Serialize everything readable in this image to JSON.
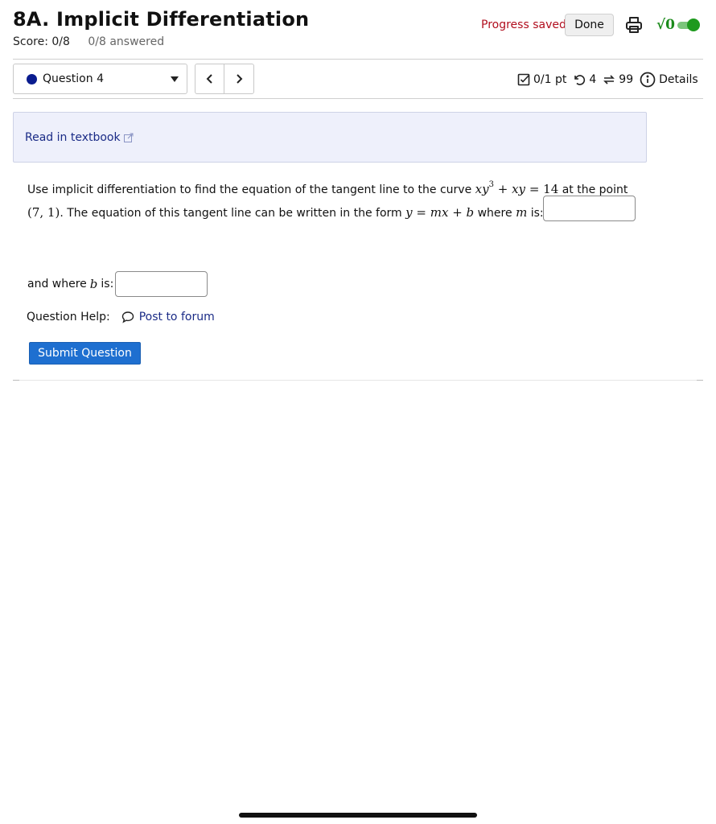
{
  "header": {
    "title": "8A. Implicit Differentiation",
    "score": "Score: 0/8",
    "answered": "0/8 answered",
    "progress_saved": "Progress saved",
    "done_label": "Done",
    "math_toggle_symbol": "√0",
    "math_toggle_on": true
  },
  "nav": {
    "question_label": "Question 4",
    "prev_symbol": "‹",
    "next_symbol": "›"
  },
  "meta": {
    "points": "0/1 pt",
    "attempts": "4",
    "versions": "99",
    "details_label": "Details"
  },
  "textbook": {
    "link_label": "Read in textbook"
  },
  "question": {
    "text_1": "Use implicit differentiation to find the equation of the tangent line to the curve",
    "text_2": "at the point",
    "text_3": ". The equation of this tangent line can be written in the form",
    "text_4": "where",
    "text_5": "is:",
    "b_prefix": "and where",
    "b_suffix": "is:",
    "m_value": "",
    "b_value": ""
  },
  "help": {
    "label": "Question Help:",
    "forum_label": "Post to forum"
  },
  "submit": {
    "label": "Submit Question"
  },
  "colors": {
    "progress_saved": "#b10e1e",
    "link": "#1a2b86",
    "submit": "#1e6fd0",
    "toggle": "#1e9a1e",
    "question_dot": "#0a1c8f"
  }
}
